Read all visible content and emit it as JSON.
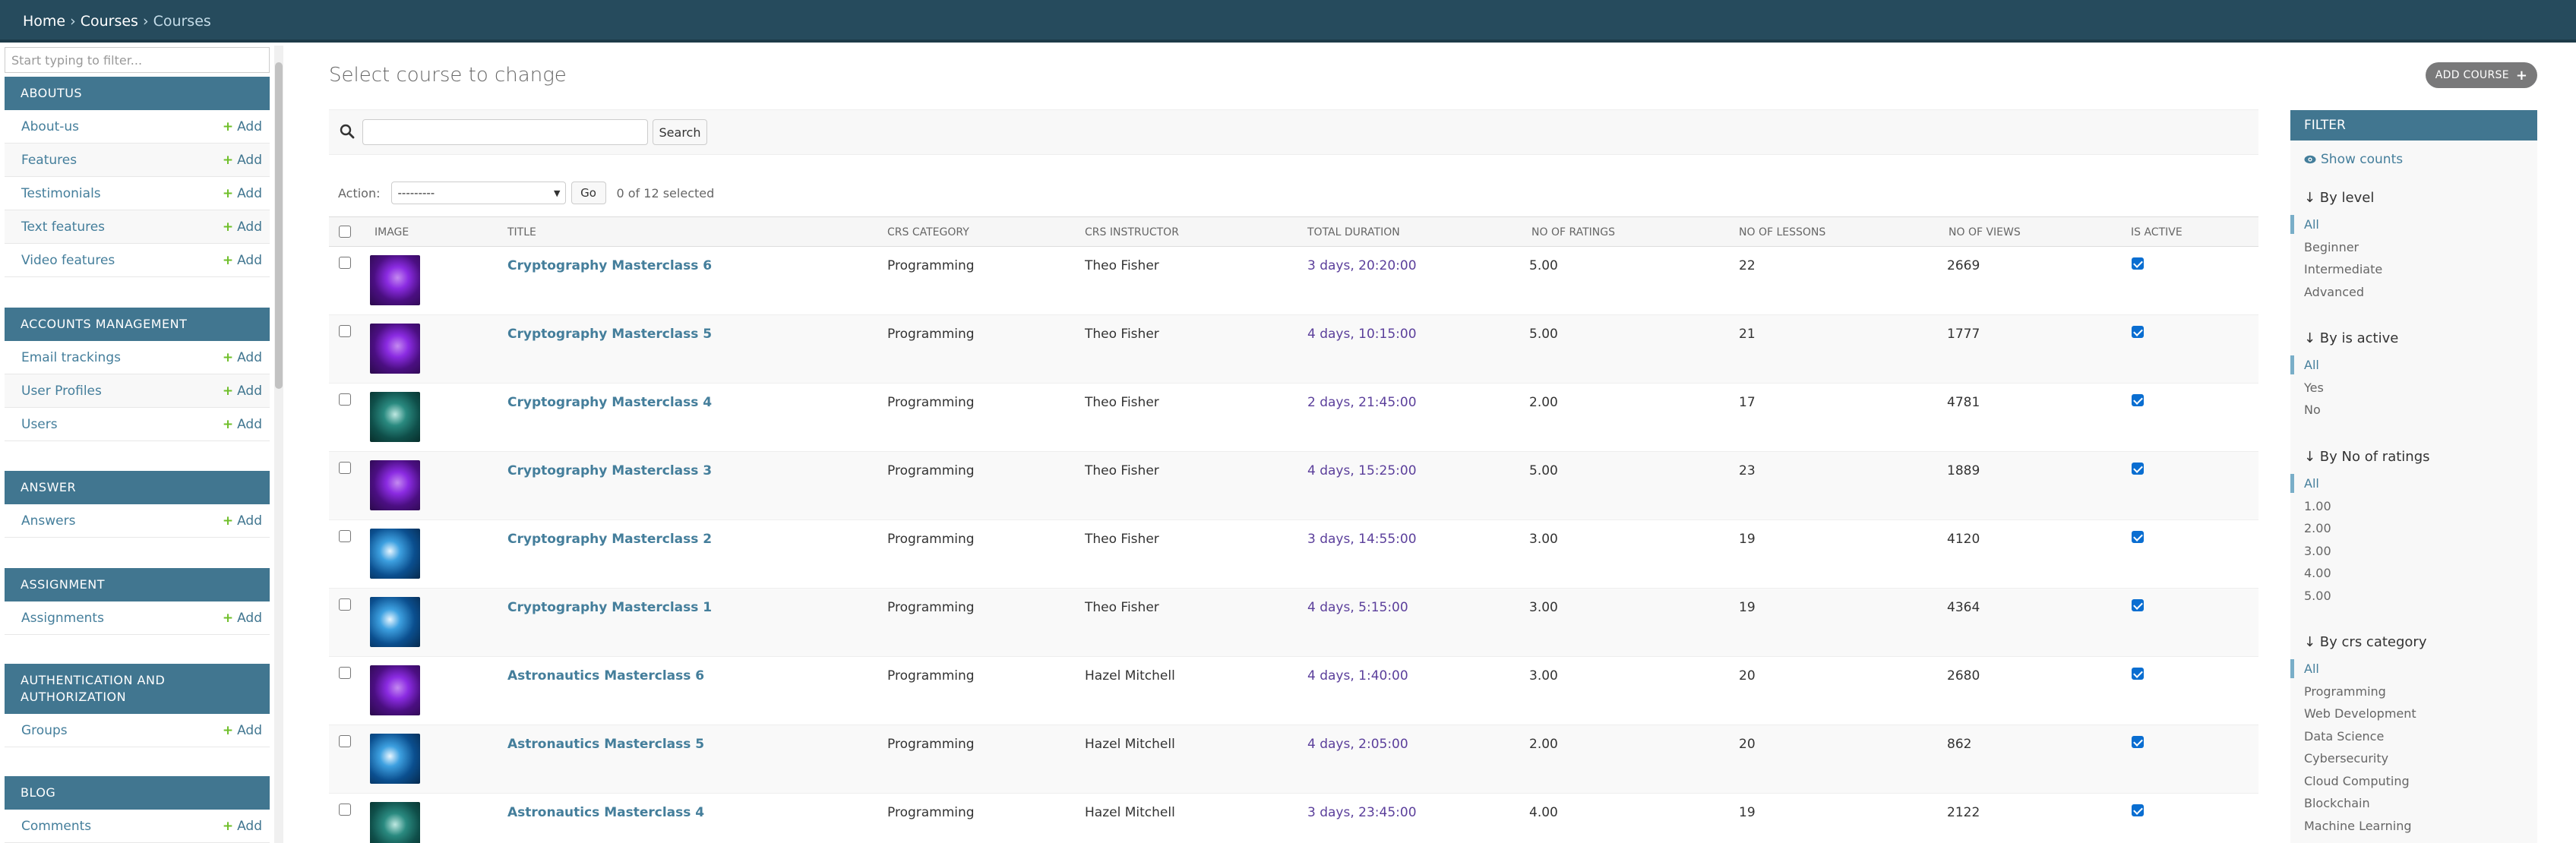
{
  "breadcrumbs": {
    "home": "Home",
    "sep": "›",
    "courses_app": "Courses",
    "current": "Courses"
  },
  "sidebar": {
    "filter_placeholder": "Start typing to filter...",
    "sections": [
      {
        "caption": "Aboutus",
        "models": [
          {
            "name": "About-us",
            "add": "Add"
          },
          {
            "name": "Features",
            "add": "Add"
          },
          {
            "name": "Testimonials",
            "add": "Add"
          },
          {
            "name": "Text features",
            "add": "Add"
          },
          {
            "name": "Video features",
            "add": "Add"
          }
        ]
      },
      {
        "caption": "Accounts Management",
        "models": [
          {
            "name": "Email trackings",
            "add": "Add"
          },
          {
            "name": "User Profiles",
            "add": "Add"
          },
          {
            "name": "Users",
            "add": "Add"
          }
        ]
      },
      {
        "caption": "Answer",
        "models": [
          {
            "name": "Answers",
            "add": "Add"
          }
        ]
      },
      {
        "caption": "Assignment",
        "models": [
          {
            "name": "Assignments",
            "add": "Add"
          }
        ]
      },
      {
        "caption": "Authentication and Authorization",
        "models": [
          {
            "name": "Groups",
            "add": "Add"
          }
        ]
      },
      {
        "caption": "Blog",
        "models": [
          {
            "name": "Comments",
            "add": "Add"
          }
        ]
      }
    ]
  },
  "page": {
    "title": "Select course to change",
    "add_button": "Add course",
    "search_button": "Search",
    "search_value": "",
    "action_label": "Action:",
    "action_selected": "---------",
    "go_button": "Go",
    "selection_counter": "0 of 12 selected"
  },
  "table": {
    "headers": [
      "Image",
      "Title",
      "Crs category",
      "Crs instructor",
      "Total duration",
      "No of ratings",
      "No of lessons",
      "No of views",
      "Is active"
    ],
    "rows": [
      {
        "image": "purple",
        "title": "Cryptography Masterclass 6",
        "category": "Programming",
        "instructor": "Theo Fisher",
        "duration": "3 days, 20:20:00",
        "ratings": "5.00",
        "lessons": "22",
        "views": "2669",
        "active": true
      },
      {
        "image": "purple",
        "title": "Cryptography Masterclass 5",
        "category": "Programming",
        "instructor": "Theo Fisher",
        "duration": "4 days, 10:15:00",
        "ratings": "5.00",
        "lessons": "21",
        "views": "1777",
        "active": true
      },
      {
        "image": "teal",
        "title": "Cryptography Masterclass 4",
        "category": "Programming",
        "instructor": "Theo Fisher",
        "duration": "2 days, 21:45:00",
        "ratings": "2.00",
        "lessons": "17",
        "views": "4781",
        "active": true
      },
      {
        "image": "purple",
        "title": "Cryptography Masterclass 3",
        "category": "Programming",
        "instructor": "Theo Fisher",
        "duration": "4 days, 15:25:00",
        "ratings": "5.00",
        "lessons": "23",
        "views": "1889",
        "active": true
      },
      {
        "image": "blue",
        "title": "Cryptography Masterclass 2",
        "category": "Programming",
        "instructor": "Theo Fisher",
        "duration": "3 days, 14:55:00",
        "ratings": "3.00",
        "lessons": "19",
        "views": "4120",
        "active": true
      },
      {
        "image": "blue",
        "title": "Cryptography Masterclass 1",
        "category": "Programming",
        "instructor": "Theo Fisher",
        "duration": "4 days, 5:15:00",
        "ratings": "3.00",
        "lessons": "19",
        "views": "4364",
        "active": true
      },
      {
        "image": "purple",
        "title": "Astronautics Masterclass 6",
        "category": "Programming",
        "instructor": "Hazel Mitchell",
        "duration": "4 days, 1:40:00",
        "ratings": "3.00",
        "lessons": "20",
        "views": "2680",
        "active": true
      },
      {
        "image": "blue",
        "title": "Astronautics Masterclass 5",
        "category": "Programming",
        "instructor": "Hazel Mitchell",
        "duration": "4 days, 2:05:00",
        "ratings": "2.00",
        "lessons": "20",
        "views": "862",
        "active": true
      },
      {
        "image": "teal",
        "title": "Astronautics Masterclass 4",
        "category": "Programming",
        "instructor": "Hazel Mitchell",
        "duration": "3 days, 23:45:00",
        "ratings": "4.00",
        "lessons": "19",
        "views": "2122",
        "active": true
      }
    ]
  },
  "filter": {
    "header": "Filter",
    "show_counts": "Show counts",
    "groups": [
      {
        "title": "↓ By level",
        "options": [
          "All",
          "Beginner",
          "Intermediate",
          "Advanced"
        ]
      },
      {
        "title": "↓ By is active",
        "options": [
          "All",
          "Yes",
          "No"
        ]
      },
      {
        "title": "↓ By No of ratings",
        "options": [
          "All",
          "1.00",
          "2.00",
          "3.00",
          "4.00",
          "5.00"
        ]
      },
      {
        "title": "↓ By crs category",
        "options": [
          "All",
          "Programming",
          "Web Development",
          "Data Science",
          "Cybersecurity",
          "Cloud Computing",
          "Blockchain",
          "Machine Learning"
        ]
      }
    ]
  },
  "colors": {
    "header": "#264b5d",
    "caption": "#417690",
    "link": "#447e9b",
    "add_plus": "#70bf2b",
    "duration": "#5b3f9b"
  }
}
